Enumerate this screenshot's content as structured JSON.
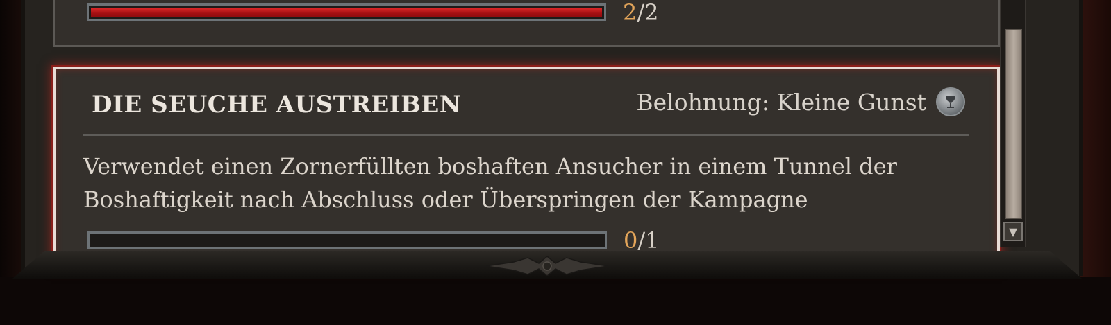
{
  "panels": [
    {
      "progress": {
        "current": "2",
        "separator": "/",
        "total": "2",
        "fraction": 1.0
      }
    },
    {
      "title": "DIE SEUCHE AUSTREIBEN",
      "reward_label": "Belohnung: Kleine Gunst",
      "reward_icon": "chalice-coin-icon",
      "description": "Verwendet einen Zornerfüllten boshaften Ansucher in einem Tunnel der Boshaftigkeit nach Abschluss oder Überspringen der Kampagne",
      "progress": {
        "current": "0",
        "separator": "/",
        "total": "1",
        "fraction": 0.0
      },
      "highlighted": true
    }
  ],
  "scrollbar": {
    "down_icon": "arrow-down-icon"
  },
  "colors": {
    "accent_red": "#d42222",
    "highlight_glow": "#c92a24",
    "progress_current": "#e3a55a",
    "text": "#dcd5cc"
  }
}
